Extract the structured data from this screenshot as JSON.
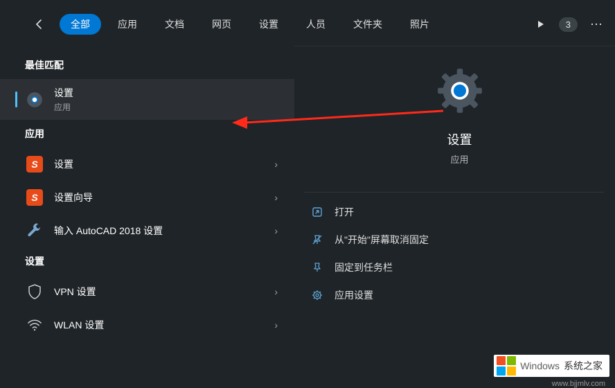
{
  "tabs": {
    "items": [
      "全部",
      "应用",
      "文档",
      "网页",
      "设置",
      "人员",
      "文件夹",
      "照片"
    ],
    "active_index": 0,
    "badge": "3"
  },
  "sections": {
    "best_match": "最佳匹配",
    "apps": "应用",
    "settings": "设置"
  },
  "results": {
    "best": {
      "title": "设置",
      "sub": "应用"
    },
    "apps": [
      {
        "title": "设置",
        "icon": "sogou"
      },
      {
        "title": "设置向导",
        "icon": "sogou"
      },
      {
        "title": "输入 AutoCAD 2018 设置",
        "icon": "wrench"
      }
    ],
    "settings_list": [
      {
        "title": "VPN 设置",
        "icon": "shield"
      },
      {
        "title": "WLAN 设置",
        "icon": "wifi"
      }
    ]
  },
  "preview": {
    "title": "设置",
    "sub": "应用",
    "actions": [
      {
        "label": "打开",
        "icon": "open"
      },
      {
        "label": "从\"开始\"屏幕取消固定",
        "icon": "unpin"
      },
      {
        "label": "固定到任务栏",
        "icon": "pin"
      },
      {
        "label": "应用设置",
        "icon": "gear"
      }
    ]
  },
  "watermark": {
    "brand": "Windows",
    "suffix": "系统之家",
    "site": "www.bjjmlv.com"
  }
}
